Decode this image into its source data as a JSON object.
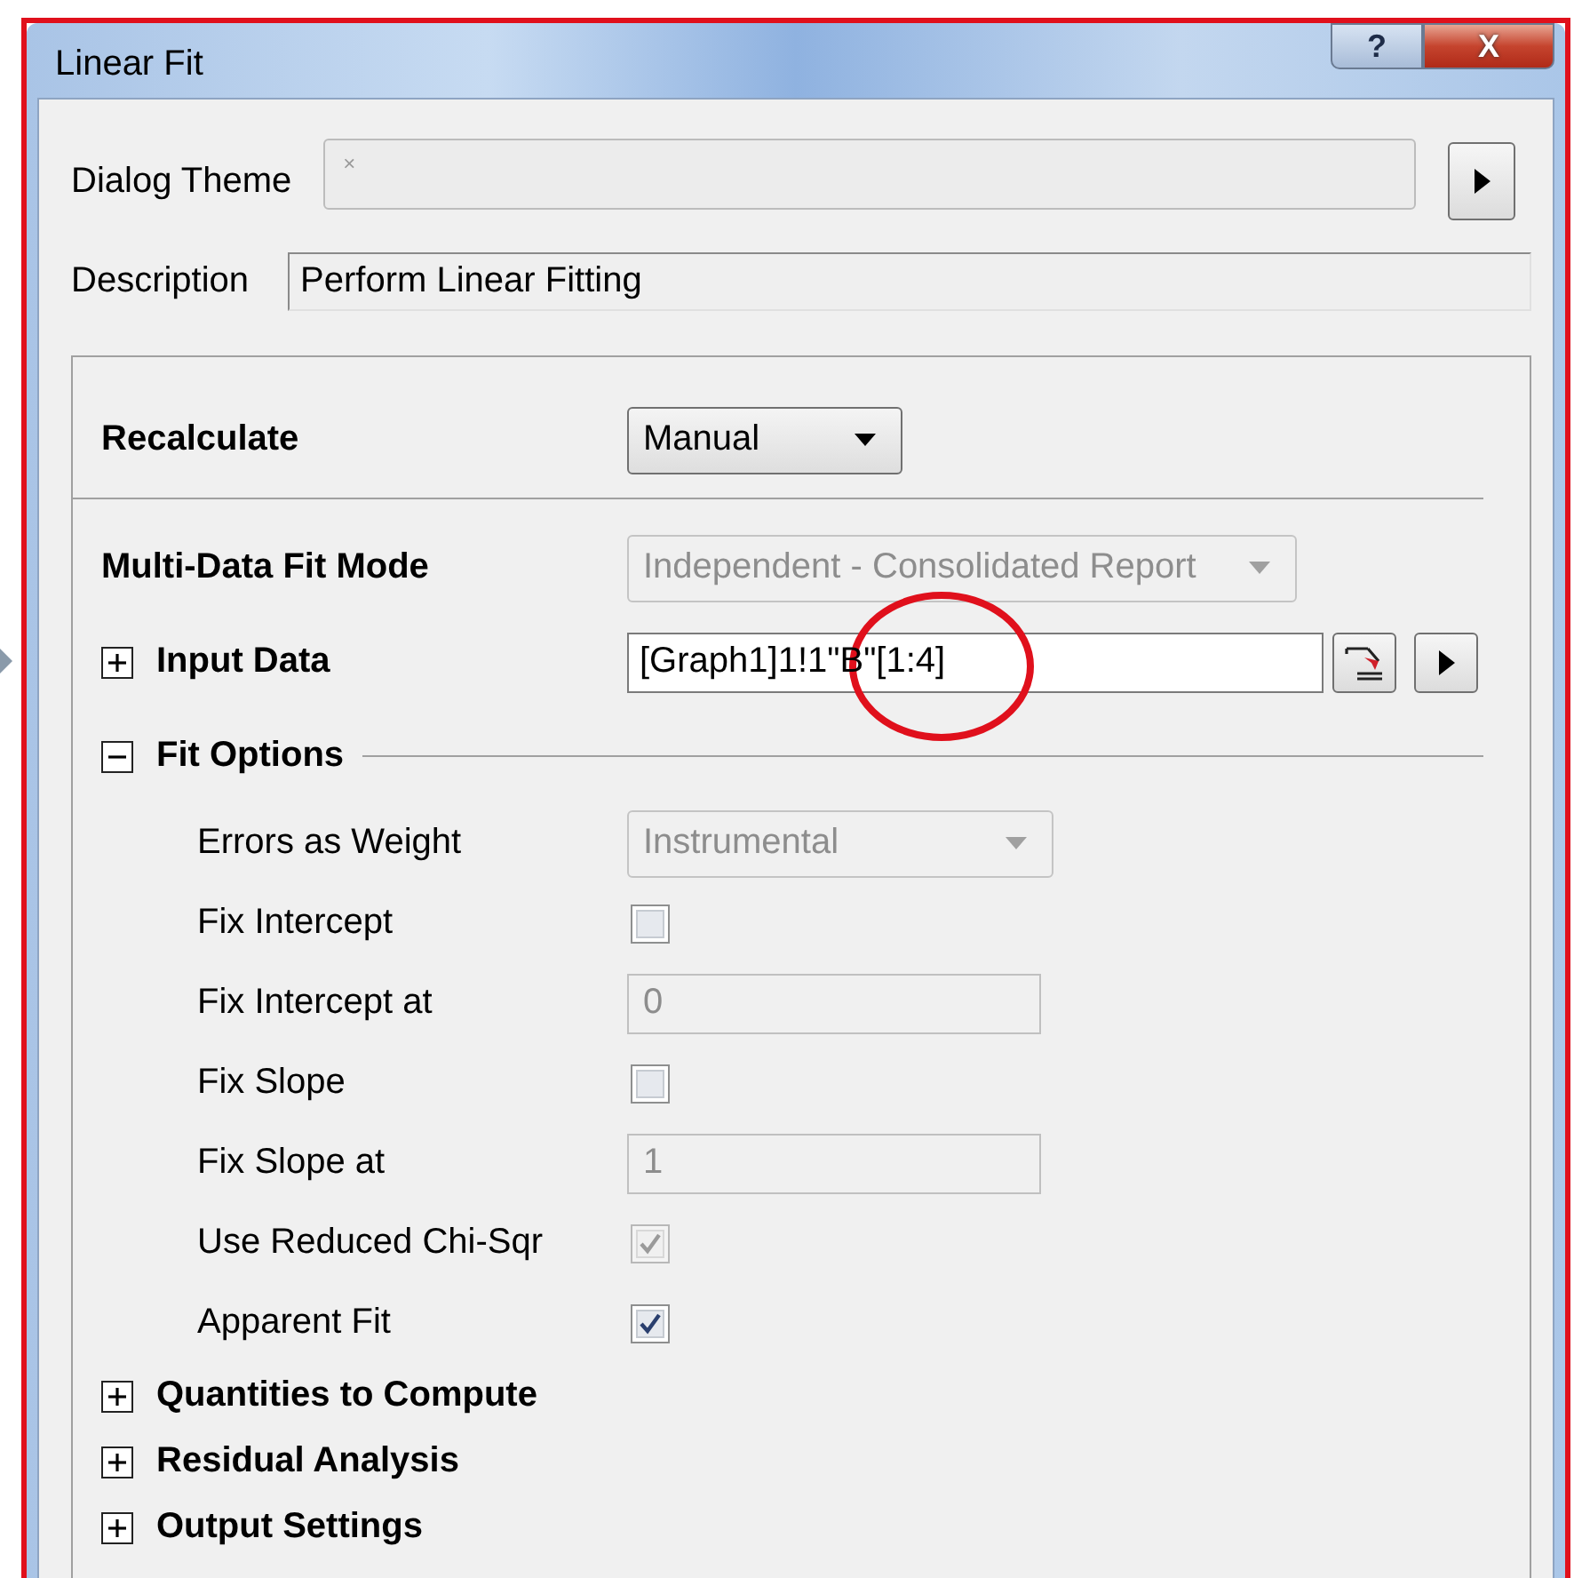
{
  "window": {
    "title": "Linear Fit",
    "help_button": "?",
    "close_button": "X"
  },
  "theme": {
    "label": "Dialog Theme",
    "value": "×"
  },
  "description": {
    "label": "Description",
    "value": "Perform Linear Fitting"
  },
  "rows": [
    {
      "kind": "combo",
      "label": "Recalculate",
      "value": "Manual",
      "disabled": false
    },
    {
      "kind": "divider"
    },
    {
      "kind": "combo",
      "label": "Multi-Data Fit Mode",
      "value": "Independent - Consolidated Report",
      "disabled": true
    },
    {
      "kind": "section",
      "label": "Input Data",
      "expanded": false,
      "highlighted": true,
      "value": "[Graph1]1!1\"B\"[1:4]"
    },
    {
      "kind": "section",
      "label": "Fit Options",
      "expanded": true,
      "children": [
        {
          "kind": "combo",
          "label": "Errors as Weight",
          "value": "Instrumental",
          "disabled": true
        },
        {
          "kind": "check",
          "label": "Fix Intercept",
          "checked": false,
          "disabled": false
        },
        {
          "kind": "text",
          "label": "Fix Intercept at",
          "value": "0",
          "disabled": true
        },
        {
          "kind": "check",
          "label": "Fix Slope",
          "checked": false,
          "disabled": false
        },
        {
          "kind": "text",
          "label": "Fix Slope at",
          "value": "1",
          "disabled": true
        },
        {
          "kind": "check",
          "label": "Use Reduced Chi-Sqr",
          "checked": true,
          "disabled": true
        },
        {
          "kind": "check",
          "label": "Apparent Fit",
          "checked": true,
          "disabled": false
        }
      ]
    },
    {
      "kind": "section",
      "label": "Quantities to Compute",
      "expanded": false
    },
    {
      "kind": "section",
      "label": "Residual Analysis",
      "expanded": false
    },
    {
      "kind": "section",
      "label": "Output Settings",
      "expanded": false
    }
  ]
}
